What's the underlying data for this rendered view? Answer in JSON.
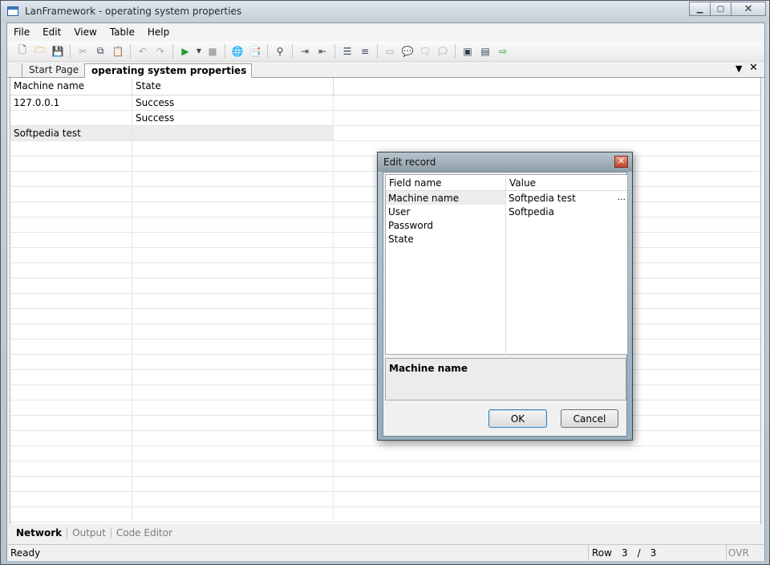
{
  "window": {
    "title": "LanFramework - operating system properties"
  },
  "menu": [
    "File",
    "Edit",
    "View",
    "Table",
    "Help"
  ],
  "tabs": {
    "start": "Start Page",
    "active": "operating system properties"
  },
  "grid": {
    "headers": [
      "Machine name",
      "State",
      ""
    ],
    "rows": [
      [
        "127.0.0.1",
        "Success"
      ],
      [
        "",
        "Success"
      ],
      [
        "Softpedia test",
        ""
      ]
    ]
  },
  "bottom_tabs": [
    "Network",
    "Output",
    "Code Editor"
  ],
  "status": {
    "ready": "Ready",
    "row_label": "Row",
    "row_current": "3",
    "row_sep": "/",
    "row_total": "3",
    "ovr": "OVR"
  },
  "dialog": {
    "title": "Edit record",
    "headers": {
      "field": "Field name",
      "value": "Value"
    },
    "fields": [
      {
        "name": "Machine name",
        "value": "Softpedia test"
      },
      {
        "name": "User",
        "value": "Softpedia"
      },
      {
        "name": "Password",
        "value": ""
      },
      {
        "name": "State",
        "value": ""
      }
    ],
    "ellipsis": "...",
    "description": "Machine name",
    "ok": "OK",
    "cancel": "Cancel",
    "close_glyph": "✕"
  }
}
